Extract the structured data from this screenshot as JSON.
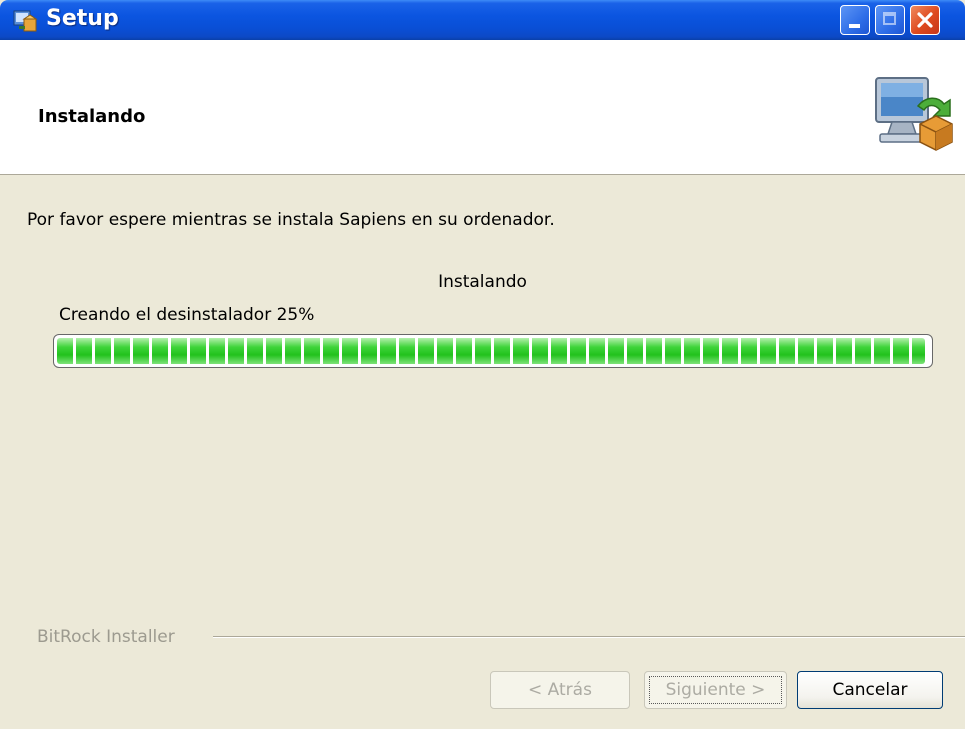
{
  "window": {
    "title": "Setup",
    "icon": "setup-app-icon",
    "controls": [
      "minimize-icon",
      "maximize-icon",
      "close-icon"
    ]
  },
  "header": {
    "title": "Instalando",
    "icon": "installer-computer-icon"
  },
  "content": {
    "message": "Por favor espere mientras se instala Sapiens en su ordenador.",
    "progress": {
      "caption": "Instalando",
      "status": "Creando el desinstalador 25%",
      "fill_percent": 100
    }
  },
  "footer": {
    "brand": "BitRock Installer",
    "buttons": {
      "back": "< Atrás",
      "next": "Siguiente >",
      "cancel": "Cancelar"
    }
  },
  "colors": {
    "titlebar": "#0b55e0",
    "progress_fill": "#22c21d",
    "dialog_background": "#ece9d8"
  }
}
